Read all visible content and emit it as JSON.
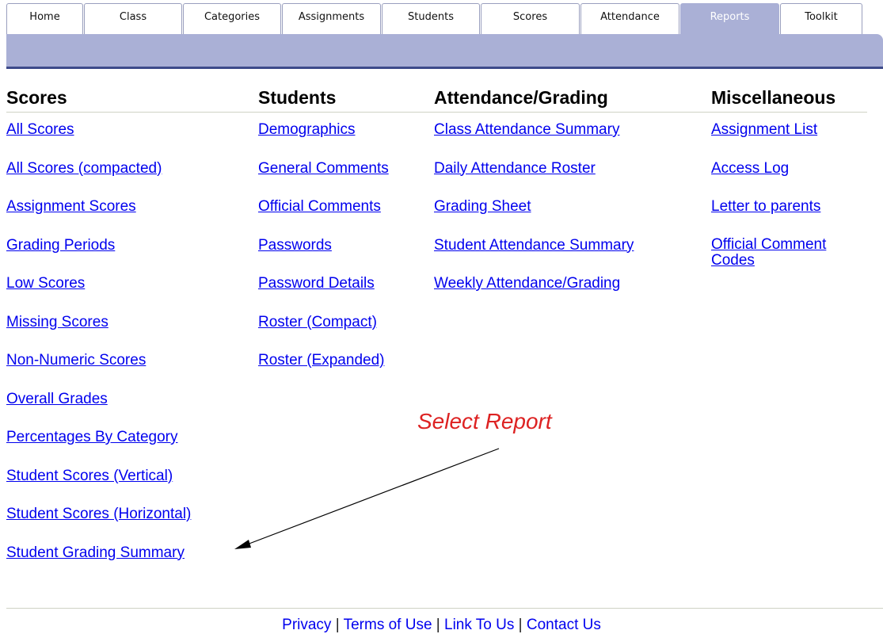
{
  "tabs": [
    {
      "label": "Home"
    },
    {
      "label": "Class"
    },
    {
      "label": "Categories"
    },
    {
      "label": "Assignments"
    },
    {
      "label": "Students"
    },
    {
      "label": "Scores"
    },
    {
      "label": "Attendance"
    },
    {
      "label": "Reports",
      "active": true
    },
    {
      "label": "Toolkit"
    }
  ],
  "columns": {
    "scores": {
      "title": "Scores",
      "links": [
        "All Scores",
        "All Scores (compacted)",
        "Assignment Scores",
        "Grading Periods",
        "Low Scores",
        "Missing Scores",
        "Non-Numeric Scores",
        "Overall Grades",
        "Percentages By Category",
        "Student Scores (Vertical)",
        "Student Scores (Horizontal)",
        "Student Grading Summary"
      ]
    },
    "students": {
      "title": "Students",
      "links": [
        "Demographics",
        "General Comments",
        "Official Comments",
        "Passwords",
        "Password Details",
        "Roster (Compact)",
        "Roster (Expanded)"
      ]
    },
    "attendance": {
      "title": "Attendance/Grading",
      "links": [
        "Class Attendance Summary",
        "Daily Attendance Roster",
        "Grading Sheet",
        "Student Attendance Summary",
        "Weekly Attendance/Grading"
      ]
    },
    "misc": {
      "title": "Miscellaneous",
      "links": [
        "Assignment List",
        "Access Log",
        "Letter to parents",
        "Official Comment Codes"
      ]
    }
  },
  "annotation": {
    "text": "Select Report",
    "color": "#dd2222"
  },
  "footer": {
    "privacy": "Privacy",
    "terms": "Terms of Use",
    "link": "Link To Us",
    "contact": "Contact Us",
    "separator": "|"
  },
  "colors": {
    "tab_band": "#aab0d6",
    "band_line": "#3d4a8a",
    "link": "#0000ee"
  }
}
